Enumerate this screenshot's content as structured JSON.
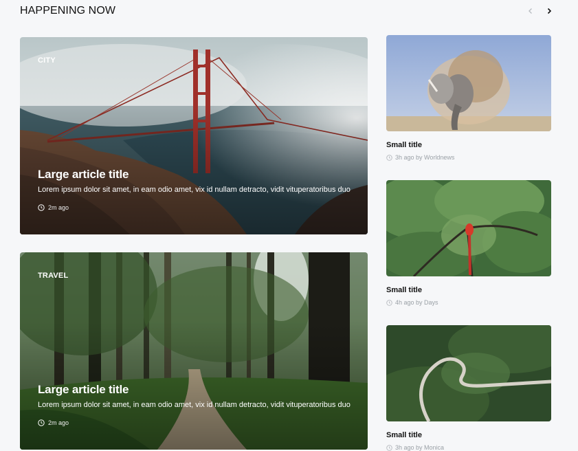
{
  "header": {
    "title": "HAPPENING NOW"
  },
  "featured": [
    {
      "category": "CITY",
      "title": "Large article title",
      "description": "Lorem ipsum dolor sit amet, in eam odio amet, vix id nullam detracto, vidit vituperatoribus duo",
      "time": "2m ago"
    },
    {
      "category": "TRAVEL",
      "title": "Large article title",
      "description": "Lorem ipsum dolor sit amet, in eam odio amet, vix id nullam detracto, vidit vituperatoribus duo",
      "time": "2m ago"
    }
  ],
  "sidebar": [
    {
      "title": "Small title",
      "meta": "3h ago by Worldnews"
    },
    {
      "title": "Small title",
      "meta": "4h ago by Days"
    },
    {
      "title": "Small title",
      "meta": "3h ago by Monica"
    }
  ]
}
